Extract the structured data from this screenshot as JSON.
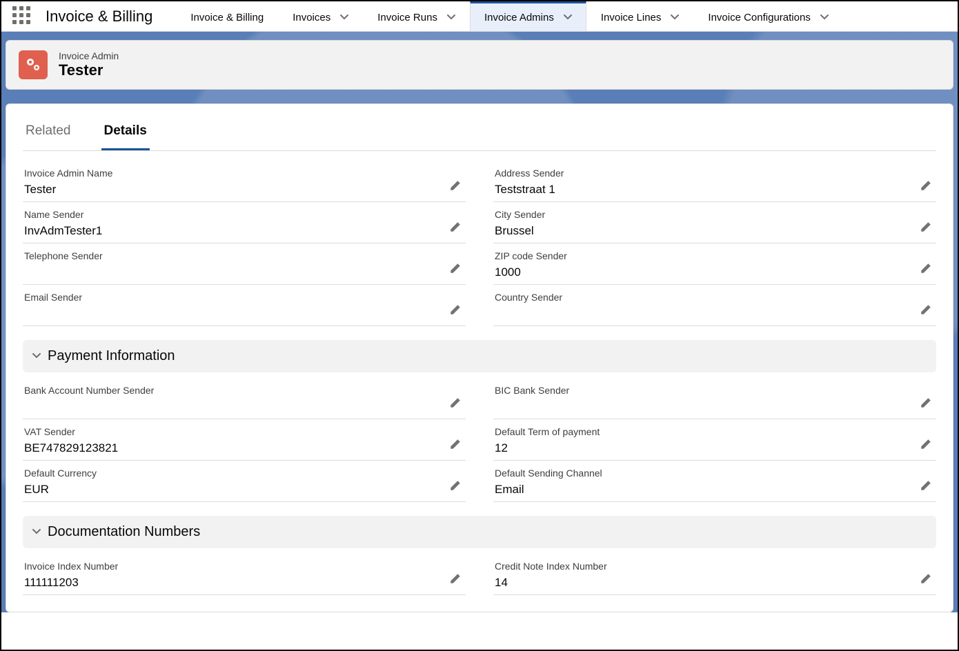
{
  "app_name": "Invoice & Billing",
  "nav": [
    {
      "label": "Invoice & Billing",
      "has_dropdown": false,
      "active": false
    },
    {
      "label": "Invoices",
      "has_dropdown": true,
      "active": false
    },
    {
      "label": "Invoice Runs",
      "has_dropdown": true,
      "active": false
    },
    {
      "label": "Invoice Admins",
      "has_dropdown": true,
      "active": true
    },
    {
      "label": "Invoice Lines",
      "has_dropdown": true,
      "active": false
    },
    {
      "label": "Invoice Configurations",
      "has_dropdown": true,
      "active": false
    }
  ],
  "record_header": {
    "object_type": "Invoice Admin",
    "title": "Tester"
  },
  "tabs": {
    "related": "Related",
    "details": "Details",
    "active": "details"
  },
  "sections": {
    "payment": "Payment Information",
    "docnum": "Documentation Numbers"
  },
  "fields": {
    "invoice_admin_name": {
      "label": "Invoice Admin Name",
      "value": "Tester"
    },
    "address_sender": {
      "label": "Address Sender",
      "value": "Teststraat 1"
    },
    "name_sender": {
      "label": "Name Sender",
      "value": "InvAdmTester1"
    },
    "city_sender": {
      "label": "City Sender",
      "value": "Brussel"
    },
    "telephone_sender": {
      "label": "Telephone Sender",
      "value": ""
    },
    "zip_sender": {
      "label": "ZIP code Sender",
      "value": "1000"
    },
    "email_sender": {
      "label": "Email Sender",
      "value": ""
    },
    "country_sender": {
      "label": "Country Sender",
      "value": ""
    },
    "bank_account": {
      "label": "Bank Account Number Sender",
      "value": ""
    },
    "bic": {
      "label": "BIC Bank Sender",
      "value": ""
    },
    "vat_sender": {
      "label": "VAT Sender",
      "value": "BE747829123821"
    },
    "default_term": {
      "label": "Default Term of payment",
      "value": "12"
    },
    "default_currency": {
      "label": "Default Currency",
      "value": "EUR"
    },
    "default_channel": {
      "label": "Default Sending Channel",
      "value": "Email"
    },
    "invoice_index": {
      "label": "Invoice Index Number",
      "value": "111111203"
    },
    "credit_note_index": {
      "label": "Credit Note Index Number",
      "value": "14"
    }
  }
}
